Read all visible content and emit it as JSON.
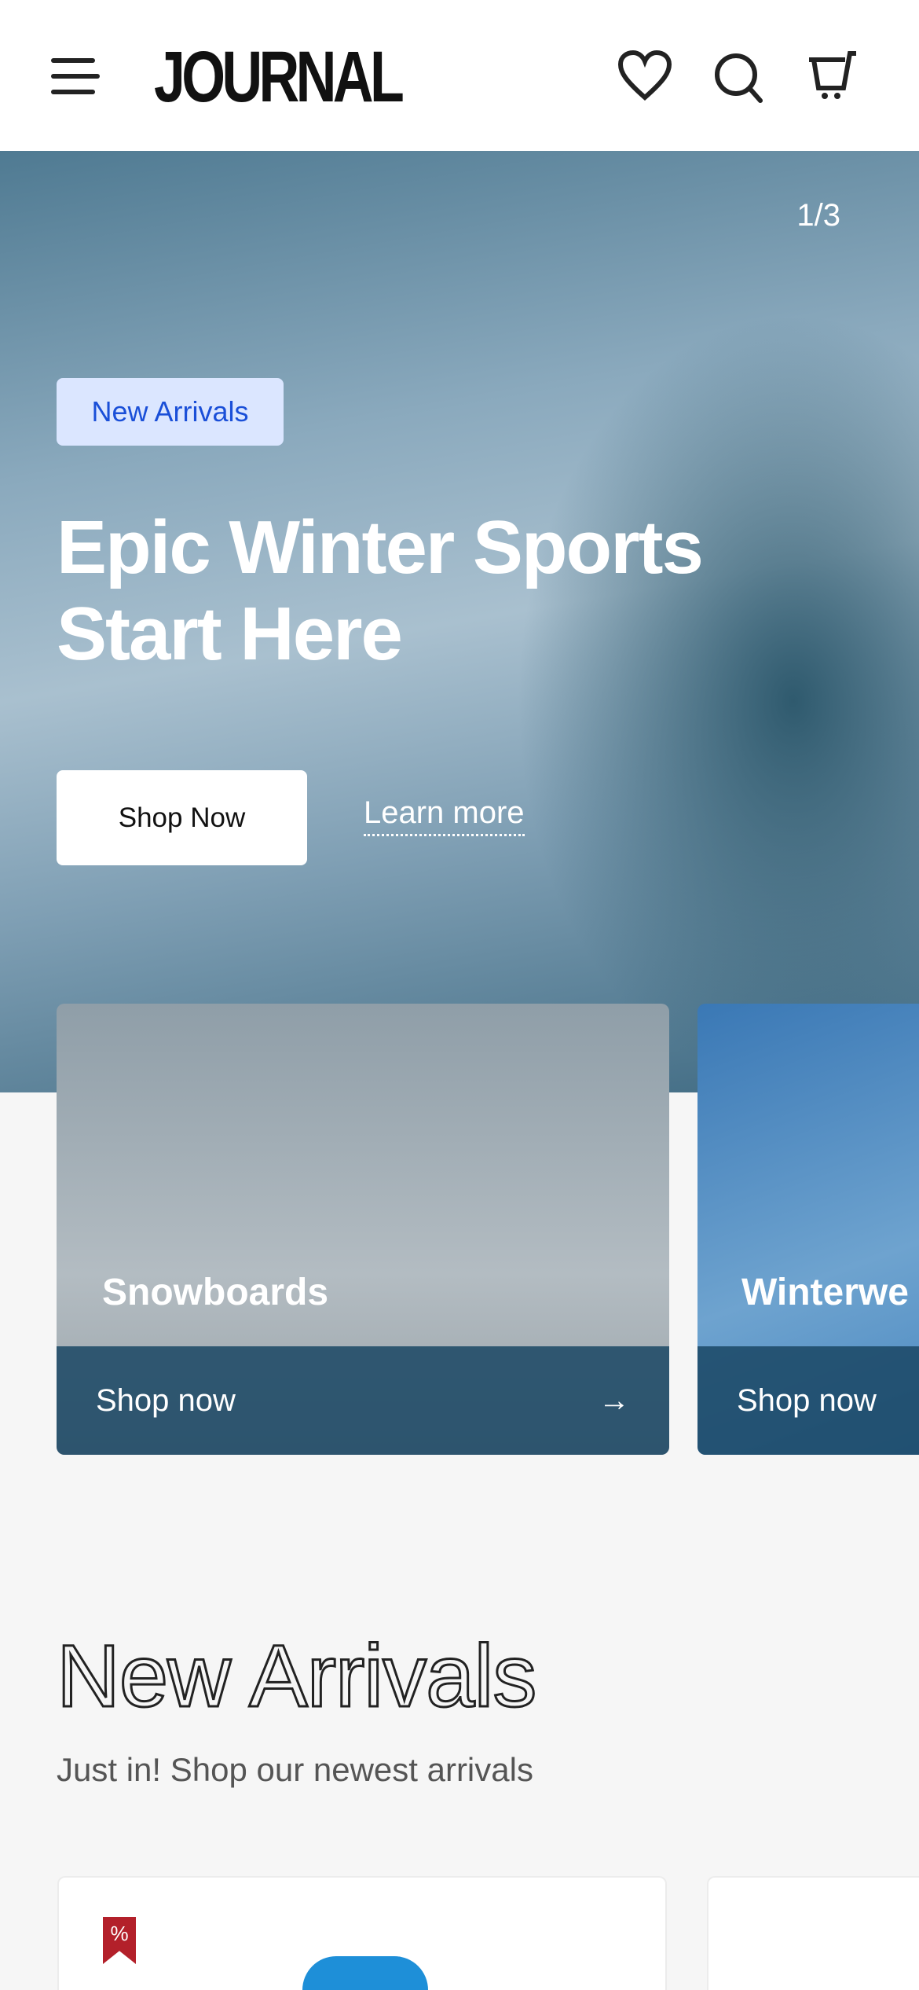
{
  "header": {
    "logo": "JOURNAL",
    "icons": [
      "menu-icon",
      "heart-icon",
      "search-icon",
      "cart-icon"
    ]
  },
  "hero": {
    "counter": "1/3",
    "badge": "New Arrivals",
    "title_line1": "Epic Winter Sports",
    "title_line2": "Start Here",
    "primary_button": "Shop Now",
    "secondary_link": "Learn more"
  },
  "categories": [
    {
      "name": "Snowboards",
      "cta": "Shop now"
    },
    {
      "name": "Winterwe",
      "cta": "Shop now"
    }
  ],
  "new_arrivals": {
    "title": "New Arrivals",
    "subtitle": "Just in! Shop our newest arrivals",
    "sale_badge": "%"
  },
  "colors": {
    "badge_bg": "#dbe6ff",
    "badge_text": "#1a4fd8",
    "sale": "#b3202a"
  }
}
